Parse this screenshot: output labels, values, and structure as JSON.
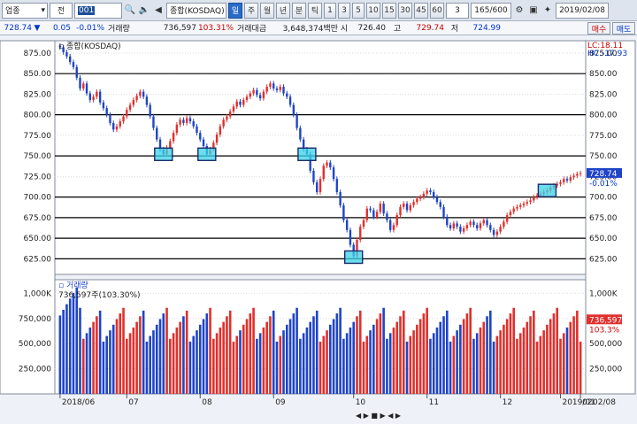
{
  "toolbar": {
    "category": "업종",
    "mode": "전",
    "code": "001",
    "name": "종합(KOSDAQ)",
    "active_period": "일",
    "periods": [
      "일",
      "주",
      "월",
      "년",
      "분",
      "틱"
    ],
    "numbers": [
      "1",
      "3",
      "5",
      "10",
      "15",
      "30",
      "45",
      "60"
    ],
    "interval": "3",
    "count": "165/600",
    "date": "2019/02/08"
  },
  "price_bar": {
    "last": "728.74",
    "change_arrow": "▼",
    "change": "0.05",
    "change_pct": "-0.01%",
    "volume_label": "거래량",
    "volume": "736,597",
    "volume_ratio": "103.31%",
    "amount_label": "거래대금",
    "amount": "3,648,374백만",
    "open_label": "시",
    "open": "726.40",
    "high_label": "고",
    "high": "729.74",
    "low_label": "저",
    "low": "724.99",
    "buy_label": "매수",
    "sell_label": "매도"
  },
  "chart_data": [
    {
      "type": "candlestick",
      "title": "종합(KOSDAQ)",
      "y_ticks": [
        "875.00",
        "850.00",
        "825.00",
        "800.00",
        "775.00",
        "750.00",
        "725.00",
        "700.00",
        "675.00",
        "650.00",
        "625.00"
      ],
      "ylim": [
        606,
        890
      ],
      "x_labels": [
        "2018/06",
        "07",
        "08",
        "09",
        "10",
        "11",
        "12",
        "2019/01",
        "02"
      ],
      "markers": {
        "lc": "LC:18.11",
        "hc": "HC:-17.93",
        "last": "728.74",
        "last_pct": "-0.01%"
      },
      "horizontal_lines": [
        850,
        800,
        750,
        700,
        675,
        650,
        625
      ],
      "close": [
        882,
        876,
        871,
        864,
        858,
        845,
        832,
        838,
        826,
        818,
        822,
        828,
        815,
        808,
        800,
        790,
        782,
        786,
        792,
        798,
        806,
        812,
        818,
        823,
        828,
        822,
        812,
        798,
        784,
        770,
        758,
        752,
        760,
        768,
        778,
        788,
        794,
        790,
        796,
        792,
        786,
        778,
        770,
        762,
        752,
        758,
        766,
        776,
        786,
        794,
        798,
        804,
        810,
        816,
        812,
        818,
        822,
        826,
        830,
        824,
        820,
        828,
        834,
        838,
        832,
        830,
        834,
        826,
        822,
        812,
        800,
        784,
        770,
        758,
        752,
        732,
        718,
        706,
        722,
        738,
        742,
        736,
        722,
        706,
        690,
        672,
        660,
        642,
        628,
        648,
        664,
        672,
        686,
        684,
        676,
        682,
        692,
        680,
        672,
        660,
        666,
        678,
        688,
        692,
        684,
        690,
        694,
        698,
        700,
        704,
        708,
        706,
        700,
        694,
        688,
        676,
        666,
        662,
        668,
        664,
        658,
        662,
        666,
        670,
        666,
        662,
        668,
        672,
        666,
        660,
        654,
        658,
        664,
        670,
        678,
        682,
        686,
        688,
        690,
        692,
        694,
        696,
        700,
        702,
        704,
        706,
        708,
        712,
        714,
        716,
        718,
        722,
        720,
        724,
        726,
        728,
        729
      ],
      "volume": {
        "label": "거래량",
        "current": "736,597주(103.30%)",
        "y_ticks": [
          "1,000K",
          "750,000",
          "500,000",
          "250,000"
        ],
        "ylim": [
          0,
          1100000
        ],
        "last": "736,597",
        "last_pct": "103.3%"
      }
    }
  ],
  "footer": {
    "left_date": "02/08",
    "highlight_boxes": "cyan"
  }
}
